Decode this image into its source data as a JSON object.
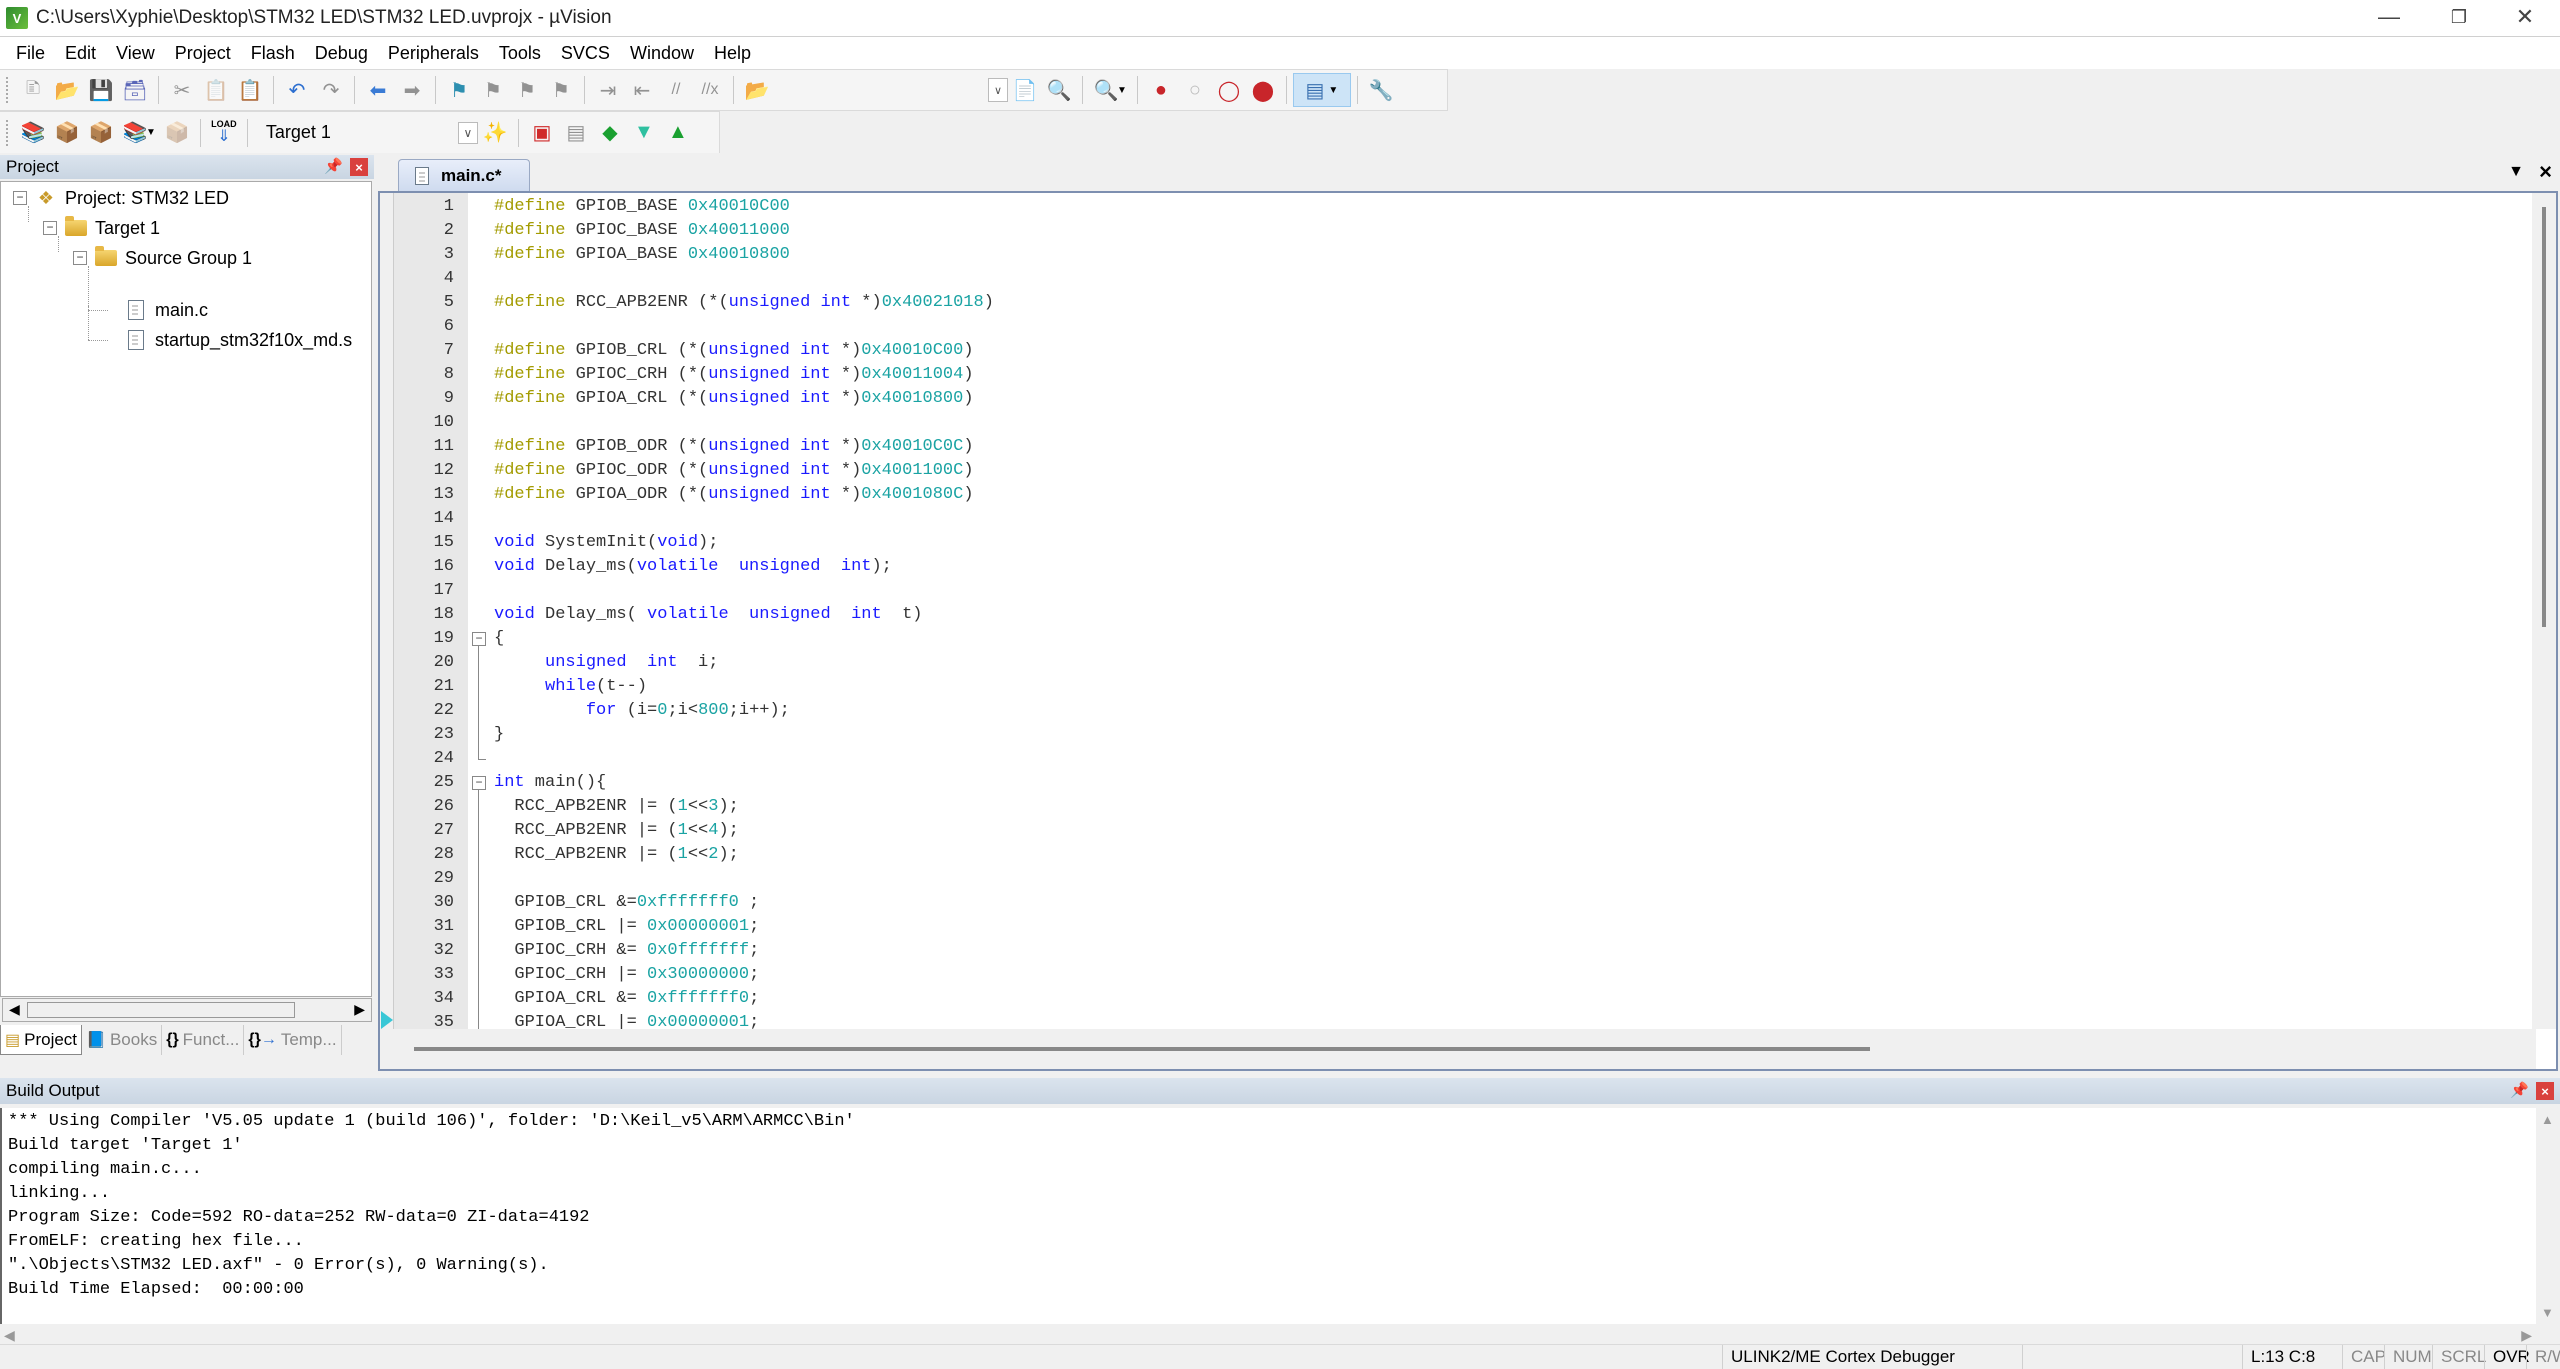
{
  "window": {
    "title": "C:\\Users\\Xyphie\\Desktop\\STM32 LED\\STM32 LED.uvprojx - µVision",
    "app_icon": "uvision-logo-icon",
    "controls": [
      "minimize-icon",
      "restore-icon",
      "close-icon"
    ]
  },
  "menu": [
    "File",
    "Edit",
    "View",
    "Project",
    "Flash",
    "Debug",
    "Peripherals",
    "Tools",
    "SVCS",
    "Window",
    "Help"
  ],
  "toolbar1": {
    "icons": [
      "new-file-icon",
      "open-file-icon",
      "save-icon",
      "save-all-icon",
      "cut-icon",
      "copy-icon",
      "paste-icon",
      "undo-icon",
      "redo-icon",
      "navigate-back-icon",
      "navigate-forward-icon",
      "insert-bookmark-icon",
      "prev-bookmark-icon",
      "next-bookmark-icon",
      "clear-bookmarks-icon",
      "indent-icon",
      "unindent-icon",
      "comment-icon",
      "uncomment-icon",
      "find-in-files-icon",
      "find-icon",
      "incremental-find-icon",
      "start-debug-icon",
      "insert-breakpoint-icon",
      "enable-breakpoint-icon",
      "disable-all-breakpoints-icon",
      "kill-all-breakpoints-icon",
      "window-layout-icon",
      "configure-icon"
    ]
  },
  "toolbar2": {
    "icons": [
      "translate-icon",
      "build-icon",
      "rebuild-icon",
      "batch-build-icon",
      "stop-build-icon",
      "download-icon",
      "target-options-icon",
      "file-extensions-icon",
      "manage-rte-icon",
      "select-packs-icon",
      "pack-installer-icon",
      "load-label"
    ],
    "load_label": "LOAD",
    "target_select": "Target 1"
  },
  "project_panel": {
    "title": "Project",
    "tree": [
      {
        "label": "Project: STM32 LED",
        "level": 0,
        "icon": "project-icon",
        "expanded": true
      },
      {
        "label": "Target 1",
        "level": 1,
        "icon": "target-folder-icon",
        "expanded": true
      },
      {
        "label": "Source Group 1",
        "level": 2,
        "icon": "folder-icon",
        "expanded": true
      },
      {
        "label": "main.c",
        "level": 3,
        "icon": "file-icon"
      },
      {
        "label": "startup_stm32f10x_md.s",
        "level": 3,
        "icon": "file-icon"
      }
    ],
    "tabs": [
      {
        "label": "Project",
        "icon": "project-tab-icon",
        "active": true
      },
      {
        "label": "Books",
        "icon": "books-icon",
        "active": false
      },
      {
        "label": "Funct...",
        "icon": "functions-icon",
        "active": false
      },
      {
        "label": "Temp...",
        "icon": "templates-icon",
        "active": false
      }
    ]
  },
  "editor": {
    "tab_label": "main.c*",
    "lines": [
      {
        "n": 1,
        "tokens": [
          [
            "pp",
            "#define"
          ],
          [
            "t",
            " GPIOB_BASE "
          ],
          [
            "num",
            "0x40010C00"
          ]
        ]
      },
      {
        "n": 2,
        "tokens": [
          [
            "pp",
            "#define"
          ],
          [
            "t",
            " GPIOC_BASE "
          ],
          [
            "num",
            "0x40011000"
          ]
        ]
      },
      {
        "n": 3,
        "tokens": [
          [
            "pp",
            "#define"
          ],
          [
            "t",
            " GPIOA_BASE "
          ],
          [
            "num",
            "0x40010800"
          ]
        ]
      },
      {
        "n": 4,
        "tokens": []
      },
      {
        "n": 5,
        "tokens": [
          [
            "pp",
            "#define"
          ],
          [
            "t",
            " RCC_APB2ENR (*("
          ],
          [
            "kw",
            "unsigned int"
          ],
          [
            "t",
            " *)"
          ],
          [
            "num",
            "0x40021018"
          ],
          [
            "t",
            ")"
          ]
        ]
      },
      {
        "n": 6,
        "tokens": []
      },
      {
        "n": 7,
        "tokens": [
          [
            "pp",
            "#define"
          ],
          [
            "t",
            " GPIOB_CRL (*("
          ],
          [
            "kw",
            "unsigned int"
          ],
          [
            "t",
            " *)"
          ],
          [
            "num",
            "0x40010C00"
          ],
          [
            "t",
            ")"
          ]
        ]
      },
      {
        "n": 8,
        "tokens": [
          [
            "pp",
            "#define"
          ],
          [
            "t",
            " GPIOC_CRH (*("
          ],
          [
            "kw",
            "unsigned int"
          ],
          [
            "t",
            " *)"
          ],
          [
            "num",
            "0x40011004"
          ],
          [
            "t",
            ")"
          ]
        ]
      },
      {
        "n": 9,
        "tokens": [
          [
            "pp",
            "#define"
          ],
          [
            "t",
            " GPIOA_CRL (*("
          ],
          [
            "kw",
            "unsigned int"
          ],
          [
            "t",
            " *)"
          ],
          [
            "num",
            "0x40010800"
          ],
          [
            "t",
            ")"
          ]
        ]
      },
      {
        "n": 10,
        "tokens": []
      },
      {
        "n": 11,
        "tokens": [
          [
            "pp",
            "#define"
          ],
          [
            "t",
            " GPIOB_ODR (*("
          ],
          [
            "kw",
            "unsigned int"
          ],
          [
            "t",
            " *)"
          ],
          [
            "num",
            "0x40010C0C"
          ],
          [
            "t",
            ")"
          ]
        ]
      },
      {
        "n": 12,
        "tokens": [
          [
            "pp",
            "#define"
          ],
          [
            "t",
            " GPIOC_ODR (*("
          ],
          [
            "kw",
            "unsigned int"
          ],
          [
            "t",
            " *)"
          ],
          [
            "num",
            "0x4001100C"
          ],
          [
            "t",
            ")"
          ]
        ]
      },
      {
        "n": 13,
        "tokens": [
          [
            "pp",
            "#define"
          ],
          [
            "t",
            " GPIOA_ODR (*("
          ],
          [
            "kw",
            "unsigned int"
          ],
          [
            "t",
            " *)"
          ],
          [
            "num",
            "0x4001080C"
          ],
          [
            "t",
            ")"
          ]
        ]
      },
      {
        "n": 14,
        "tokens": []
      },
      {
        "n": 15,
        "tokens": [
          [
            "kw",
            "void"
          ],
          [
            "t",
            " SystemInit("
          ],
          [
            "kw",
            "void"
          ],
          [
            "t",
            ");"
          ]
        ]
      },
      {
        "n": 16,
        "tokens": [
          [
            "kw",
            "void"
          ],
          [
            "t",
            " Delay_ms("
          ],
          [
            "kw",
            "volatile  unsigned  int"
          ],
          [
            "t",
            ");"
          ]
        ]
      },
      {
        "n": 17,
        "tokens": []
      },
      {
        "n": 18,
        "tokens": [
          [
            "kw",
            "void"
          ],
          [
            "t",
            " Delay_ms( "
          ],
          [
            "kw",
            "volatile  unsigned  int"
          ],
          [
            "t",
            "  t)"
          ]
        ]
      },
      {
        "n": 19,
        "tokens": [
          [
            "t",
            "{"
          ]
        ],
        "fold": "start"
      },
      {
        "n": 20,
        "tokens": [
          [
            "t",
            "     "
          ],
          [
            "kw",
            "unsigned  int"
          ],
          [
            "t",
            "  i;"
          ]
        ]
      },
      {
        "n": 21,
        "tokens": [
          [
            "t",
            "     "
          ],
          [
            "kw",
            "while"
          ],
          [
            "t",
            "(t--)"
          ]
        ]
      },
      {
        "n": 22,
        "tokens": [
          [
            "t",
            "         "
          ],
          [
            "kw",
            "for"
          ],
          [
            "t",
            " (i="
          ],
          [
            "num",
            "0"
          ],
          [
            "t",
            ";i<"
          ],
          [
            "num",
            "800"
          ],
          [
            "t",
            ";i++);"
          ]
        ]
      },
      {
        "n": 23,
        "tokens": [
          [
            "t",
            "}"
          ]
        ]
      },
      {
        "n": 24,
        "tokens": [],
        "fold": "end"
      },
      {
        "n": 25,
        "tokens": [
          [
            "kw",
            "int"
          ],
          [
            "t",
            " main(){"
          ]
        ],
        "fold": "start"
      },
      {
        "n": 26,
        "tokens": [
          [
            "t",
            "  RCC_APB2ENR |= ("
          ],
          [
            "num",
            "1"
          ],
          [
            "t",
            "<<"
          ],
          [
            "num",
            "3"
          ],
          [
            "t",
            ");"
          ]
        ]
      },
      {
        "n": 27,
        "tokens": [
          [
            "t",
            "  RCC_APB2ENR |= ("
          ],
          [
            "num",
            "1"
          ],
          [
            "t",
            "<<"
          ],
          [
            "num",
            "4"
          ],
          [
            "t",
            ");"
          ]
        ]
      },
      {
        "n": 28,
        "tokens": [
          [
            "t",
            "  RCC_APB2ENR |= ("
          ],
          [
            "num",
            "1"
          ],
          [
            "t",
            "<<"
          ],
          [
            "num",
            "2"
          ],
          [
            "t",
            ");"
          ]
        ]
      },
      {
        "n": 29,
        "tokens": []
      },
      {
        "n": 30,
        "tokens": [
          [
            "t",
            "  GPIOB_CRL &="
          ],
          [
            "num",
            "0xfffffff0"
          ],
          [
            "t",
            " ;"
          ]
        ]
      },
      {
        "n": 31,
        "tokens": [
          [
            "t",
            "  GPIOB_CRL |= "
          ],
          [
            "num",
            "0x00000001"
          ],
          [
            "t",
            ";"
          ]
        ]
      },
      {
        "n": 32,
        "tokens": [
          [
            "t",
            "  GPIOC_CRH &= "
          ],
          [
            "num",
            "0x0fffffff"
          ],
          [
            "t",
            ";"
          ]
        ]
      },
      {
        "n": 33,
        "tokens": [
          [
            "t",
            "  GPIOC_CRH |= "
          ],
          [
            "num",
            "0x30000000"
          ],
          [
            "t",
            ";"
          ]
        ]
      },
      {
        "n": 34,
        "tokens": [
          [
            "t",
            "  GPIOA_CRL &= "
          ],
          [
            "num",
            "0xfffffff0"
          ],
          [
            "t",
            ";"
          ]
        ]
      },
      {
        "n": 35,
        "tokens": [
          [
            "t",
            "  GPIOA_CRL |= "
          ],
          [
            "num",
            "0x00000001"
          ],
          [
            "t",
            ";"
          ]
        ]
      }
    ],
    "current_line_marker": 35
  },
  "build_output": {
    "title": "Build Output",
    "lines": [
      "*** Using Compiler 'V5.05 update 1 (build 106)', folder: 'D:\\Keil_v5\\ARM\\ARMCC\\Bin'",
      "Build target 'Target 1'",
      "compiling main.c...",
      "linking...",
      "Program Size: Code=592 RO-data=252 RW-data=0 ZI-data=4192",
      "FromELF: creating hex file...",
      "\".\\Objects\\STM32 LED.axf\" - 0 Error(s), 0 Warning(s).",
      "Build Time Elapsed:  00:00:00"
    ]
  },
  "statusbar": {
    "debugger": "ULINK2/ME Cortex Debugger",
    "position": "L:13 C:8",
    "cap": "CAP",
    "num": "NUM",
    "scrl": "SCRL",
    "ovr": "OVR",
    "rw": "R/W"
  },
  "colors": {
    "keyword": "#1a1aff",
    "preprocessor": "#a39b00",
    "number": "#1aa3a3",
    "close_button": "#d9413e",
    "exec_marker": "#39c7d6"
  }
}
